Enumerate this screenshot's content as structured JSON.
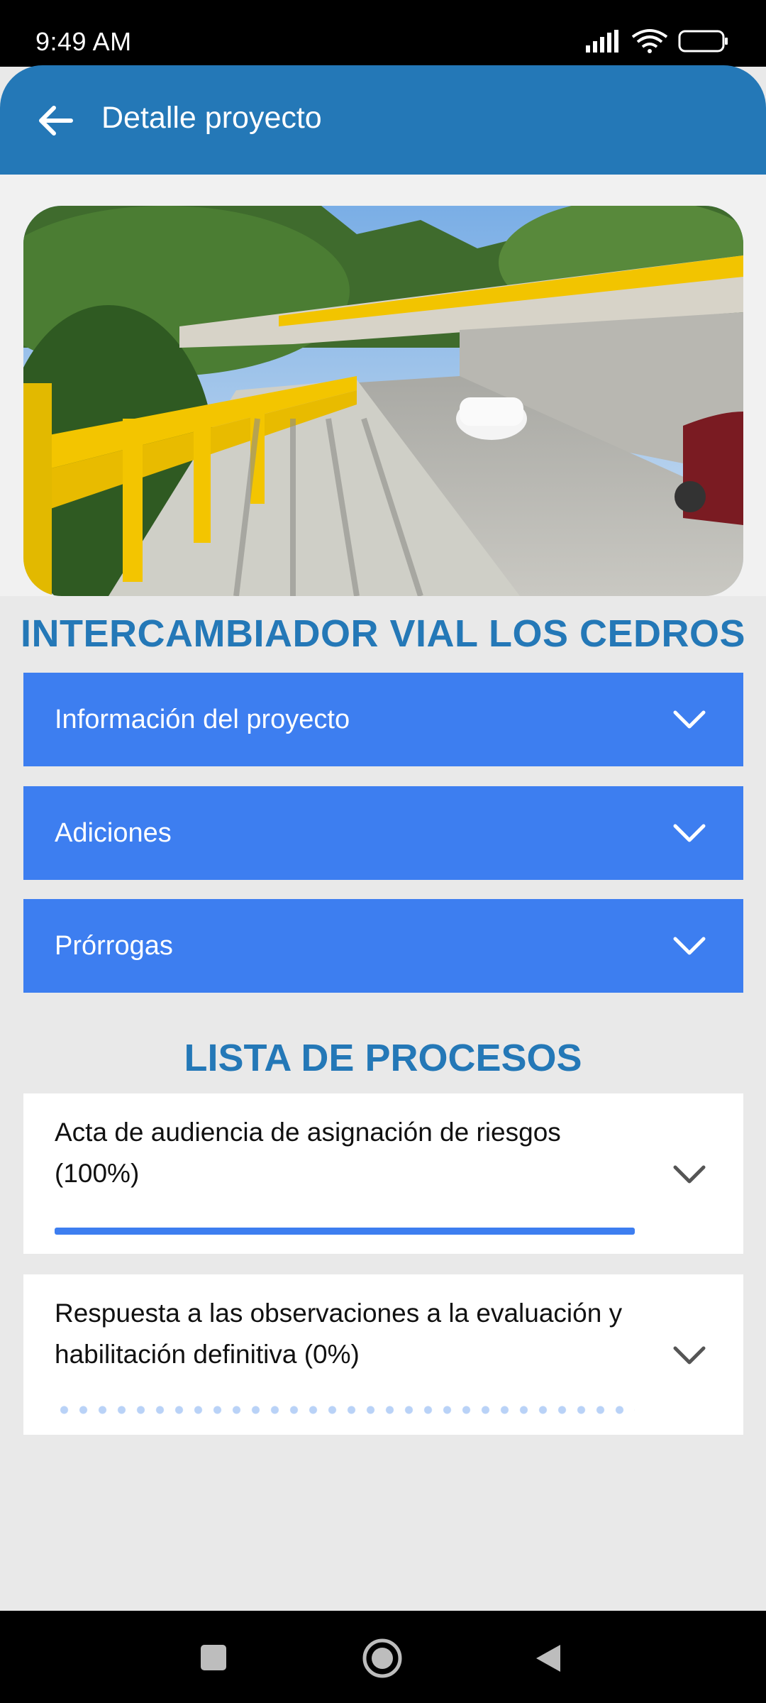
{
  "status_bar": {
    "time": "9:49 AM",
    "icons": [
      "signal-icon",
      "wifi-icon",
      "battery-icon"
    ]
  },
  "app_bar": {
    "title": "Detalle proyecto",
    "back_icon": "arrow-left-icon"
  },
  "project": {
    "name": "INTERCAMBIADOR VIAL LOS CEDROS"
  },
  "accordions": [
    {
      "label": "Información del proyecto"
    },
    {
      "label": "Adiciones"
    },
    {
      "label": "Prórrogas"
    }
  ],
  "processes": {
    "title": "LISTA DE PROCESOS",
    "items": [
      {
        "label": "Acta de audiencia de asignación de riesgos (100%)",
        "progress": 1.0
      },
      {
        "label": "Respuesta a las observaciones a la evaluación y habilitación definitiva (0%)",
        "progress": 0.0
      }
    ]
  },
  "colors": {
    "app_bar": "#2478b7",
    "accordion": "#3d7ef0",
    "title_text": "#2478b7"
  }
}
